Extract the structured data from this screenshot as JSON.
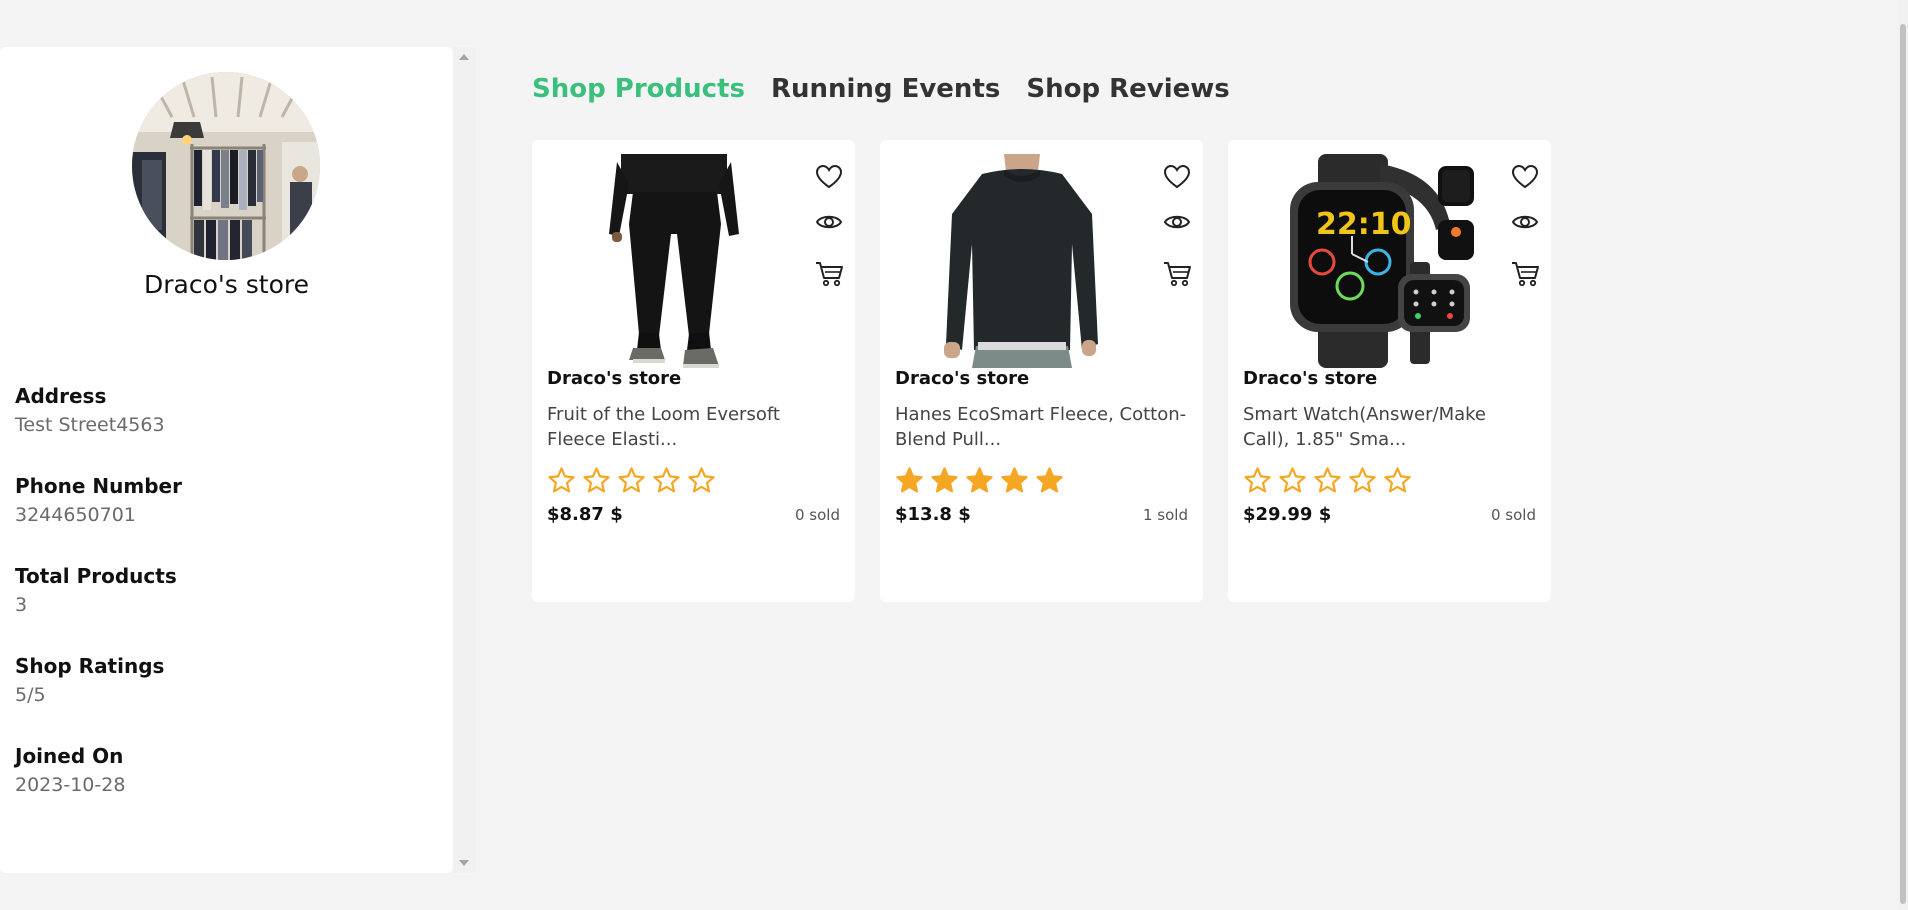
{
  "shop": {
    "name": "Draco's store",
    "info": [
      {
        "label": "Address",
        "value": "Test Street4563"
      },
      {
        "label": "Phone Number",
        "value": "3244650701"
      },
      {
        "label": "Total Products",
        "value": "3"
      },
      {
        "label": "Shop Ratings",
        "value": "5/5"
      },
      {
        "label": "Joined On",
        "value": "2023-10-28"
      }
    ]
  },
  "tabs": [
    {
      "label": "Shop Products",
      "active": true
    },
    {
      "label": "Running Events",
      "active": false
    },
    {
      "label": "Shop Reviews",
      "active": false
    }
  ],
  "products": [
    {
      "store": "Draco's store",
      "name": "Fruit of the Loom Eversoft Fleece Elasti...",
      "rating": 0,
      "price": "$8.87 $",
      "sold": "0 sold",
      "image": "black-sweatpants"
    },
    {
      "store": "Draco's store",
      "name": "Hanes EcoSmart Fleece, Cotton-Blend Pull...",
      "rating": 5,
      "price": "$13.8 $",
      "sold": "1 sold",
      "image": "dark-sweatshirt"
    },
    {
      "store": "Draco's store",
      "name": "Smart Watch(Answer/Make Call), 1.85\" Sma...",
      "rating": 0,
      "price": "$29.99 $",
      "sold": "0 sold",
      "image": "smart-watch"
    }
  ],
  "icons": {
    "wishlist": "heart-icon",
    "quick_view": "eye-icon",
    "add_to_cart": "cart-icon",
    "rating": "star-icon"
  },
  "colors": {
    "accent": "#3bbf7c",
    "star": "#f5a623",
    "background": "#f4f4f4"
  }
}
